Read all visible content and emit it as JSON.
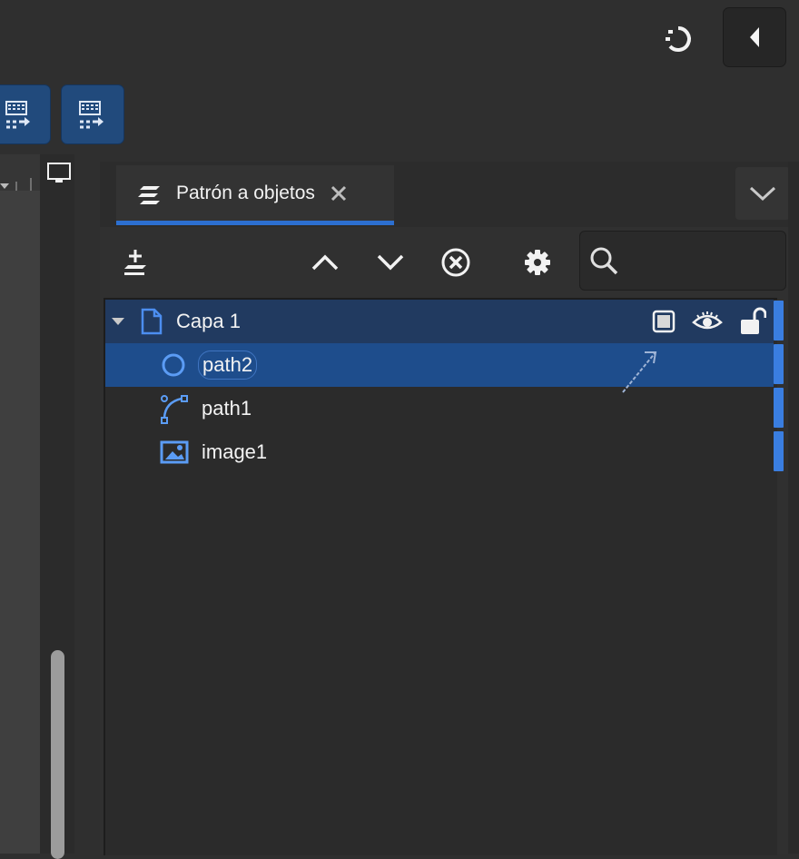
{
  "colors": {
    "accent": "#2c6fd0",
    "selection": "#1e4d8c",
    "layer_row": "#213a60",
    "icon_blue": "#4c8ef0",
    "background": "#2f2f2f"
  },
  "topbar": {
    "undo_history_icon": "restore-icon",
    "collapse_panel_icon": "triangle-left-icon"
  },
  "left_buttons": [
    {
      "icon": "pattern-to-objects-icon"
    },
    {
      "icon": "pattern-to-objects-icon"
    }
  ],
  "display_mode_icon": "monitor-icon",
  "dialog": {
    "tab": {
      "title": "Patrón a objetos",
      "icon": "stack-icon",
      "close_icon": "close-icon"
    },
    "menu_icon": "chevron-down-icon",
    "toolbar": {
      "add_layer_icon": "add-layer-icon",
      "raise_icon": "chevron-up-icon",
      "lower_icon": "chevron-down-icon",
      "delete_icon": "circle-x-icon",
      "settings_icon": "gear-icon",
      "search_icon": "search-icon",
      "search_value": "",
      "search_placeholder": ""
    },
    "tree": {
      "layer": {
        "label": "Capa 1",
        "expanded": true,
        "icons": [
          "layer-page-icon",
          "checkbox-icon",
          "eye-icon",
          "unlock-icon"
        ]
      },
      "items": [
        {
          "label": "path2",
          "type": "circle",
          "selected": true
        },
        {
          "label": "path1",
          "type": "path",
          "selected": false
        },
        {
          "label": "image1",
          "type": "image",
          "selected": false
        }
      ]
    }
  }
}
